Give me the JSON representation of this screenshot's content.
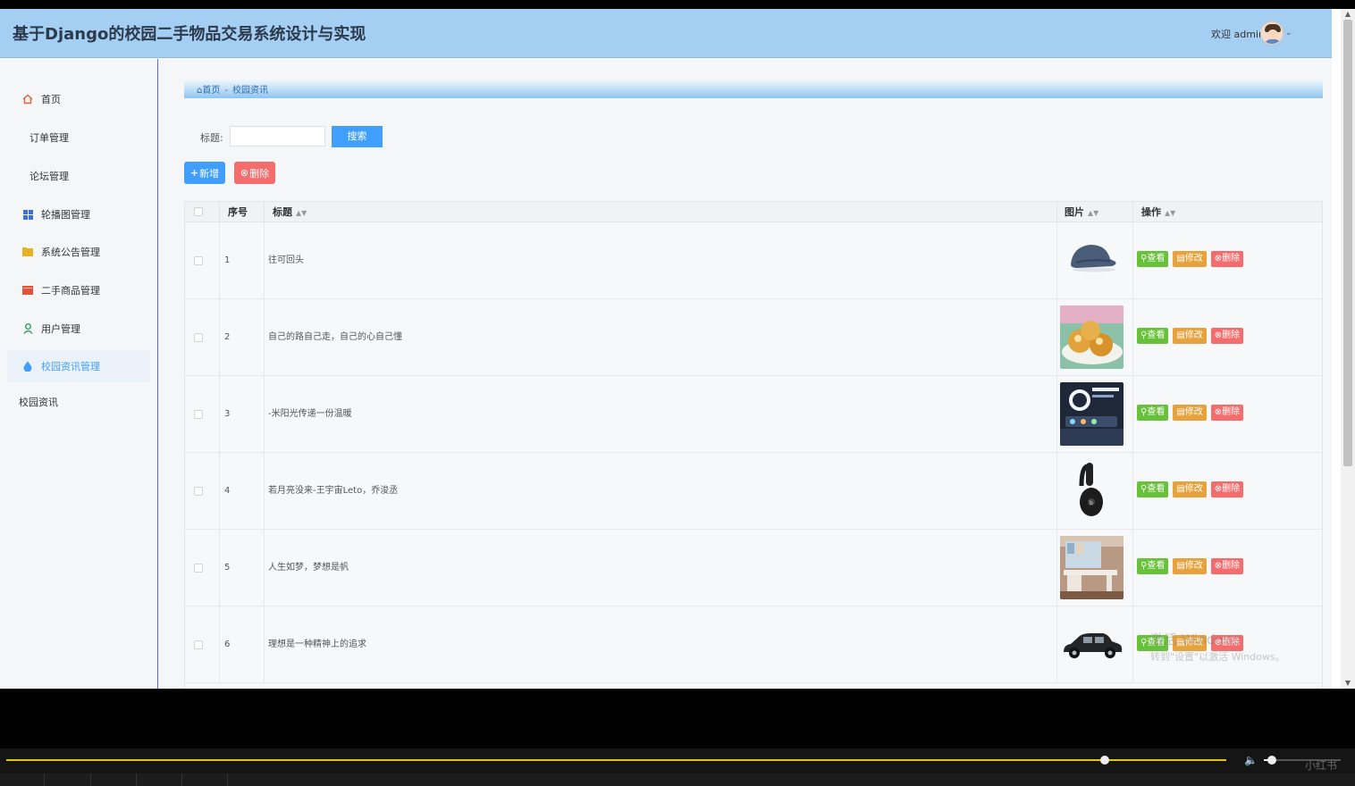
{
  "app": {
    "title": "基于Django的校园二手物品交易系统设计与实现",
    "welcome": "欢迎 admin"
  },
  "sidebar": {
    "items": [
      {
        "label": "首页",
        "icon": "home-icon",
        "color": "#e6623b"
      },
      {
        "label": "订单管理",
        "icon": "",
        "color": ""
      },
      {
        "label": "论坛管理",
        "icon": "",
        "color": ""
      },
      {
        "label": "轮播图管理",
        "icon": "grid-icon",
        "color": "#3f6fd8"
      },
      {
        "label": "系统公告管理",
        "icon": "folder-icon",
        "color": "#e6b422"
      },
      {
        "label": "二手商品管理",
        "icon": "box-icon",
        "color": "#e2543a"
      },
      {
        "label": "用户管理",
        "icon": "user-icon",
        "color": "#2f9f6a"
      },
      {
        "label": "校园资讯管理",
        "icon": "drop-icon",
        "color": "#409eff"
      }
    ],
    "sub_item": "校园资讯"
  },
  "breadcrumb": {
    "home": "首页",
    "separator": "-",
    "current": "校园资讯"
  },
  "search": {
    "label": "标题:",
    "value": "",
    "placeholder": "",
    "button": "搜索"
  },
  "actions": {
    "add": "新增",
    "delete": "删除"
  },
  "table": {
    "headers": {
      "index": "序号",
      "title": "标题",
      "image": "图片",
      "ops": "操作"
    },
    "ops_labels": {
      "view": "查看",
      "edit": "修改",
      "remove": "删除"
    },
    "rows": [
      {
        "index": "1",
        "title": "往可回头",
        "image": "cap-photo"
      },
      {
        "index": "2",
        "title": "自己的路自己走，自己的心自己懂",
        "image": "pastry-photo"
      },
      {
        "index": "3",
        "title": "-米阳光传递一份温暖",
        "image": "ring-light-photo"
      },
      {
        "index": "4",
        "title": "若月亮没来-王宇宙Leto，乔浚丞",
        "image": "headphones-photo"
      },
      {
        "index": "5",
        "title": "人生如梦，梦想是帆",
        "image": "desk-photo"
      },
      {
        "index": "6",
        "title": "理想是一种精神上的追求",
        "image": "car-photo"
      }
    ]
  },
  "watermark": {
    "line1": "激活 Windows",
    "line2": "转到\"设置\"以激活 Windows。"
  },
  "player": {
    "progress": 0.9,
    "volume": 0.1,
    "brand": "小红书",
    "accent": "#e1c500"
  }
}
